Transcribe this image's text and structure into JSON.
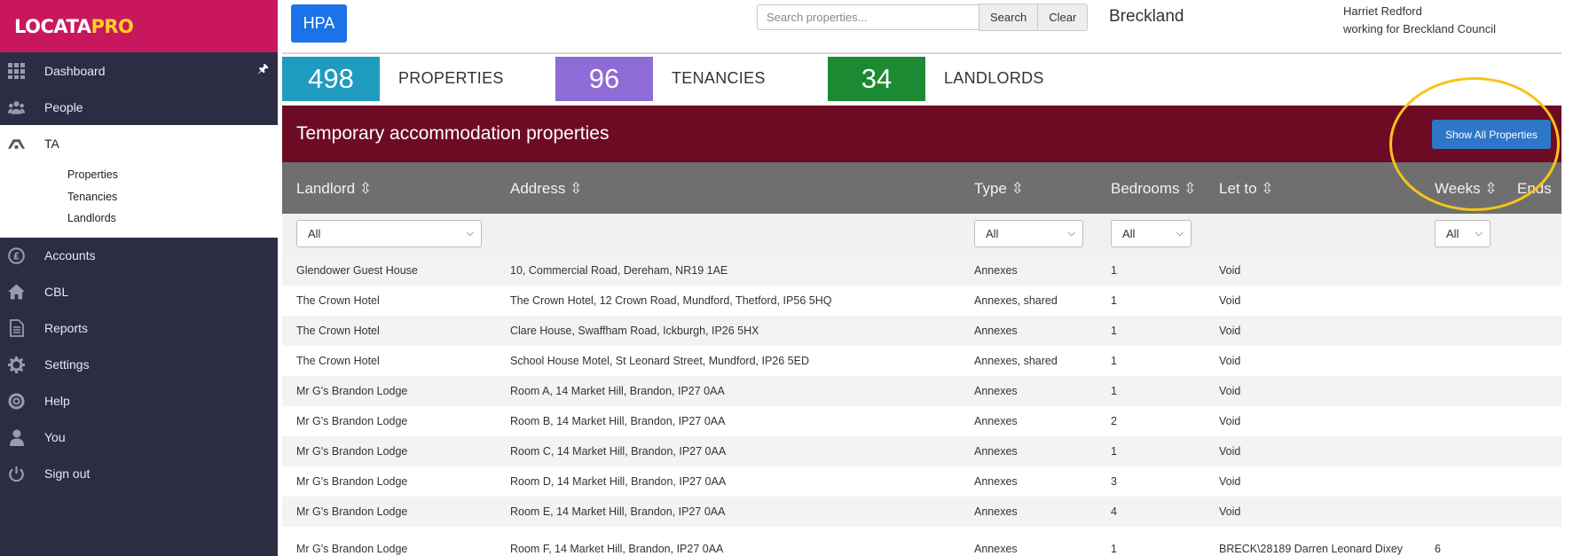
{
  "logo": {
    "part1": "LOCATA",
    "part2": "PRO"
  },
  "sidebar": {
    "items": [
      {
        "label": "Dashboard",
        "icon": "grid-icon"
      },
      {
        "label": "People",
        "icon": "people-icon"
      },
      {
        "label": "TA",
        "icon": "ta-icon"
      },
      {
        "label": "Accounts",
        "icon": "pound-icon"
      },
      {
        "label": "CBL",
        "icon": "home-icon"
      },
      {
        "label": "Reports",
        "icon": "document-icon"
      },
      {
        "label": "Settings",
        "icon": "gear-icon"
      },
      {
        "label": "Help",
        "icon": "lifebuoy-icon"
      },
      {
        "label": "You",
        "icon": "user-icon"
      },
      {
        "label": "Sign out",
        "icon": "power-icon"
      }
    ],
    "ta_subitems": [
      "Properties",
      "Tenancies",
      "Landlords"
    ]
  },
  "header": {
    "org_button": "HPA",
    "search": {
      "placeholder": "Search properties...",
      "search_label": "Search",
      "clear_label": "Clear"
    },
    "council": "Breckland",
    "user_name": "Harriet Redford",
    "user_org": "working for Breckland Council"
  },
  "stats": [
    {
      "value": "498",
      "label": "PROPERTIES",
      "color": "#1f9bbf"
    },
    {
      "value": "96",
      "label": "TENANCIES",
      "color": "#8e6bd6"
    },
    {
      "value": "34",
      "label": "LANDLORDS",
      "color": "#1c8a33"
    }
  ],
  "panel": {
    "title": "Temporary accommodation properties",
    "show_all_label": "Show All Properties",
    "header_color": "#6e0b24"
  },
  "table": {
    "columns": [
      "Landlord ⇳",
      "Address ⇳",
      "Type ⇳",
      "Bedrooms ⇳",
      "Let to ⇳",
      "Weeks ⇳",
      "Ends"
    ],
    "filters": {
      "landlord": "All",
      "type": "All",
      "bedrooms": "All",
      "weeks": "All"
    },
    "rows": [
      {
        "landlord": "Glendower Guest House",
        "address": "10, Commercial Road, Dereham, NR19 1AE",
        "type": "Annexes",
        "bedrooms": "1",
        "let_to": "Void",
        "weeks": ""
      },
      {
        "landlord": "The Crown Hotel",
        "address": "The Crown Hotel, 12 Crown Road, Mundford, Thetford, IP56 5HQ",
        "type": "Annexes, shared",
        "bedrooms": "1",
        "let_to": "Void",
        "weeks": ""
      },
      {
        "landlord": "The Crown Hotel",
        "address": "Clare House, Swaffham Road, Ickburgh, IP26 5HX",
        "type": "Annexes",
        "bedrooms": "1",
        "let_to": "Void",
        "weeks": ""
      },
      {
        "landlord": "The Crown Hotel",
        "address": "School House Motel, St Leonard Street, Mundford, IP26 5ED",
        "type": "Annexes, shared",
        "bedrooms": "1",
        "let_to": "Void",
        "weeks": ""
      },
      {
        "landlord": "Mr G's Brandon Lodge",
        "address": "Room A, 14 Market Hill, Brandon, IP27 0AA",
        "type": "Annexes",
        "bedrooms": "1",
        "let_to": "Void",
        "weeks": ""
      },
      {
        "landlord": "Mr G's Brandon Lodge",
        "address": "Room B, 14 Market Hill, Brandon, IP27 0AA",
        "type": "Annexes",
        "bedrooms": "2",
        "let_to": "Void",
        "weeks": ""
      },
      {
        "landlord": "Mr G's Brandon Lodge",
        "address": "Room C, 14 Market Hill, Brandon, IP27 0AA",
        "type": "Annexes",
        "bedrooms": "1",
        "let_to": "Void",
        "weeks": ""
      },
      {
        "landlord": "Mr G's Brandon Lodge",
        "address": "Room D, 14 Market Hill, Brandon, IP27 0AA",
        "type": "Annexes",
        "bedrooms": "3",
        "let_to": "Void",
        "weeks": ""
      },
      {
        "landlord": "Mr G's Brandon Lodge",
        "address": "Room E, 14 Market Hill, Brandon, IP27 0AA",
        "type": "Annexes",
        "bedrooms": "4",
        "let_to": "Void",
        "weeks": ""
      },
      {
        "landlord": "Mr G's Brandon Lodge",
        "address": "Room F, 14 Market Hill, Brandon, IP27 0AA",
        "type": "Annexes",
        "bedrooms": "1",
        "let_to": "BRECK\\28189 Darren Leonard Dixey",
        "weeks": "6"
      }
    ]
  }
}
